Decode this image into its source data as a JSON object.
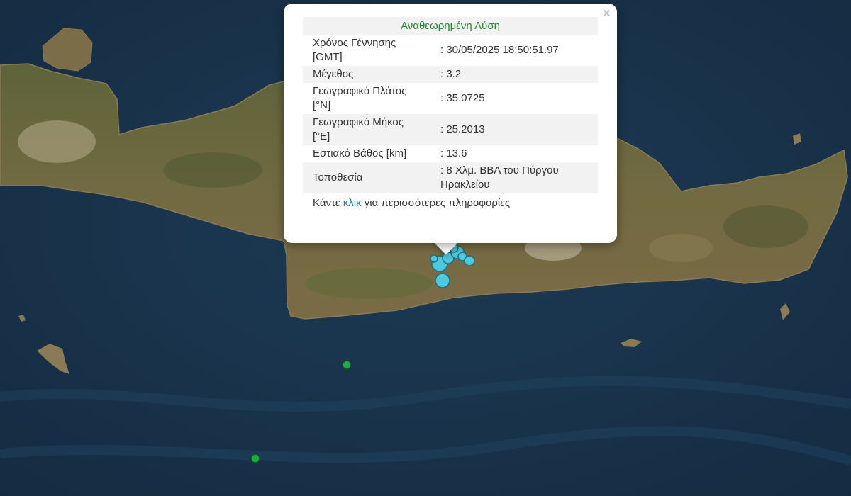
{
  "popup": {
    "title": "Αναθεωρημένη Λύση",
    "close_icon": "×",
    "rows": [
      {
        "label": "Χρόνος Γέννησης [GMT]",
        "value": ": 30/05/2025 18:50:51.97"
      },
      {
        "label": "Μέγεθος",
        "value": ": 3.2"
      },
      {
        "label": "Γεωγραφικό Πλάτος [°N]",
        "value": ": 35.0725"
      },
      {
        "label": "Γεωγραφικό Μήκος [°E]",
        "value": ": 25.2013"
      },
      {
        "label": "Εστιακό Βάθος [km]",
        "value": ": 13.6"
      },
      {
        "label": "Τοποθεσία",
        "value": ": 8 Χλμ. ΒΒΑ του Πύργου Ηρακλείου"
      }
    ],
    "more_prefix": "Κάντε ",
    "more_link": "κλικ",
    "more_suffix": " για περισσότερες πληροφορίες"
  },
  "colors": {
    "sea": "#17314a",
    "land": "#6b6a3e",
    "marker_cyan": "#4fc8de",
    "marker_green": "#22a84a",
    "title_green": "#1f8a2e",
    "link_blue": "#1a7fb8"
  }
}
